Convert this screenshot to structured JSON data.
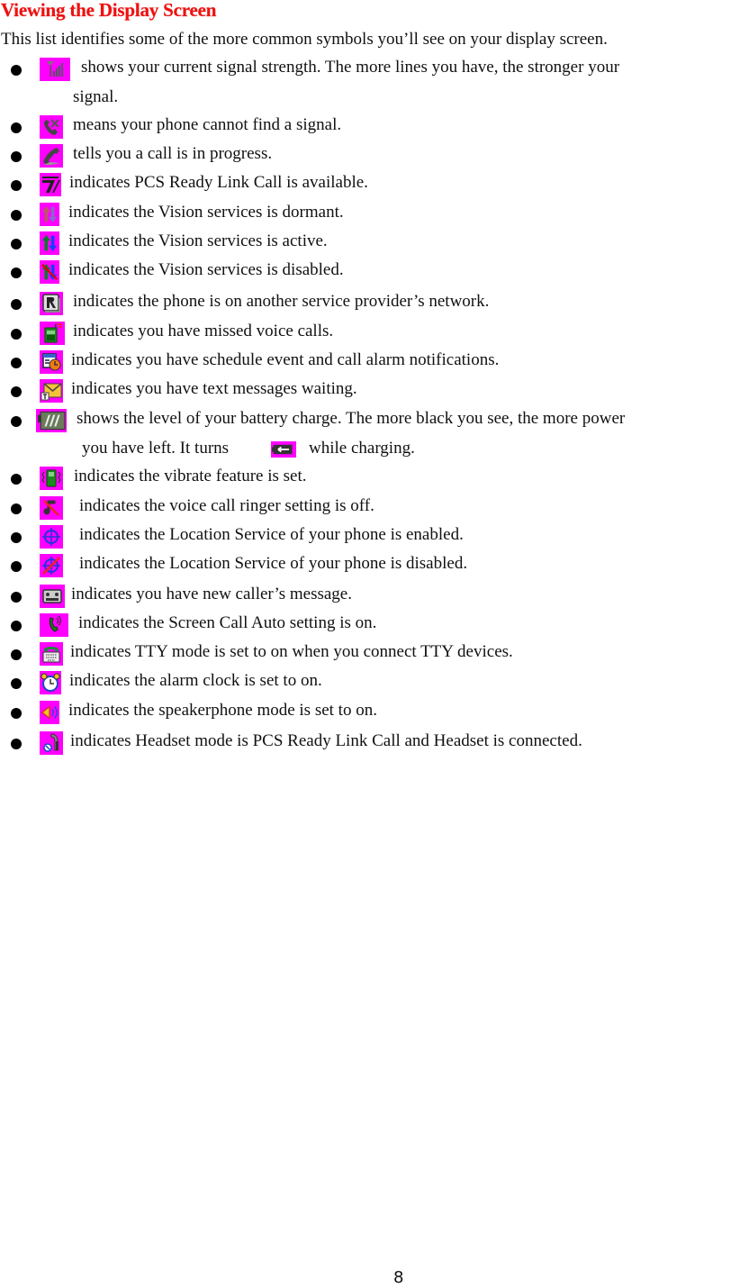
{
  "document": {
    "title": "Viewing the Display Screen",
    "intro": "This list identifies some of the more common symbols you’ll see on your display screen.",
    "page_number": "8"
  },
  "items": [
    {
      "icon": "signal-strength-icon",
      "text": "shows your current signal strength. The more lines you have, the stronger your",
      "continuation": "signal."
    },
    {
      "icon": "no-signal-icon",
      "text": "means your phone cannot find a signal."
    },
    {
      "icon": "call-in-progress-icon",
      "text": "tells you a call is in progress."
    },
    {
      "icon": "ready-link-icon",
      "text": "indicates PCS Ready Link Call is available."
    },
    {
      "icon": "vision-dormant-icon",
      "text": "indicates the Vision services is dormant."
    },
    {
      "icon": "vision-active-icon",
      "text": "indicates the Vision services is active."
    },
    {
      "icon": "vision-disabled-icon",
      "text": "indicates the Vision services is disabled."
    },
    {
      "icon": "roaming-icon",
      "text": "indicates the phone is on another service provider’s network."
    },
    {
      "icon": "missed-call-icon",
      "text": "indicates you have missed voice calls."
    },
    {
      "icon": "schedule-alarm-icon",
      "text": "indicates you have schedule event and call alarm notifications."
    },
    {
      "icon": "text-message-icon",
      "text": "indicates you have text messages waiting."
    },
    {
      "icon": "battery-icon",
      "text": "shows the level of your battery charge. The more black you see, the more power",
      "continuation_before": "you have left. It turns",
      "continuation_after": "while charging.",
      "inline_icon": "battery-charging-icon"
    },
    {
      "icon": "vibrate-icon",
      "text": "indicates the vibrate feature is set."
    },
    {
      "icon": "ringer-off-icon",
      "text": "indicates the voice call ringer setting is off."
    },
    {
      "icon": "location-on-icon",
      "text": "indicates the Location Service of your phone is enabled."
    },
    {
      "icon": "location-off-icon",
      "text": "indicates the Location Service of your phone is disabled."
    },
    {
      "icon": "voicemail-icon",
      "text": "indicates you have new caller’s message."
    },
    {
      "icon": "screen-call-icon",
      "text": "indicates the Screen Call Auto setting is on."
    },
    {
      "icon": "tty-icon",
      "text": "indicates TTY mode is set to on when you connect TTY devices."
    },
    {
      "icon": "alarm-clock-icon",
      "text": "indicates the alarm clock is set to on."
    },
    {
      "icon": "speakerphone-icon",
      "text": "indicates the speakerphone mode is set to on."
    },
    {
      "icon": "headset-icon",
      "text": "indicates Headset mode is PCS Ready Link Call and Headset is connected."
    }
  ]
}
